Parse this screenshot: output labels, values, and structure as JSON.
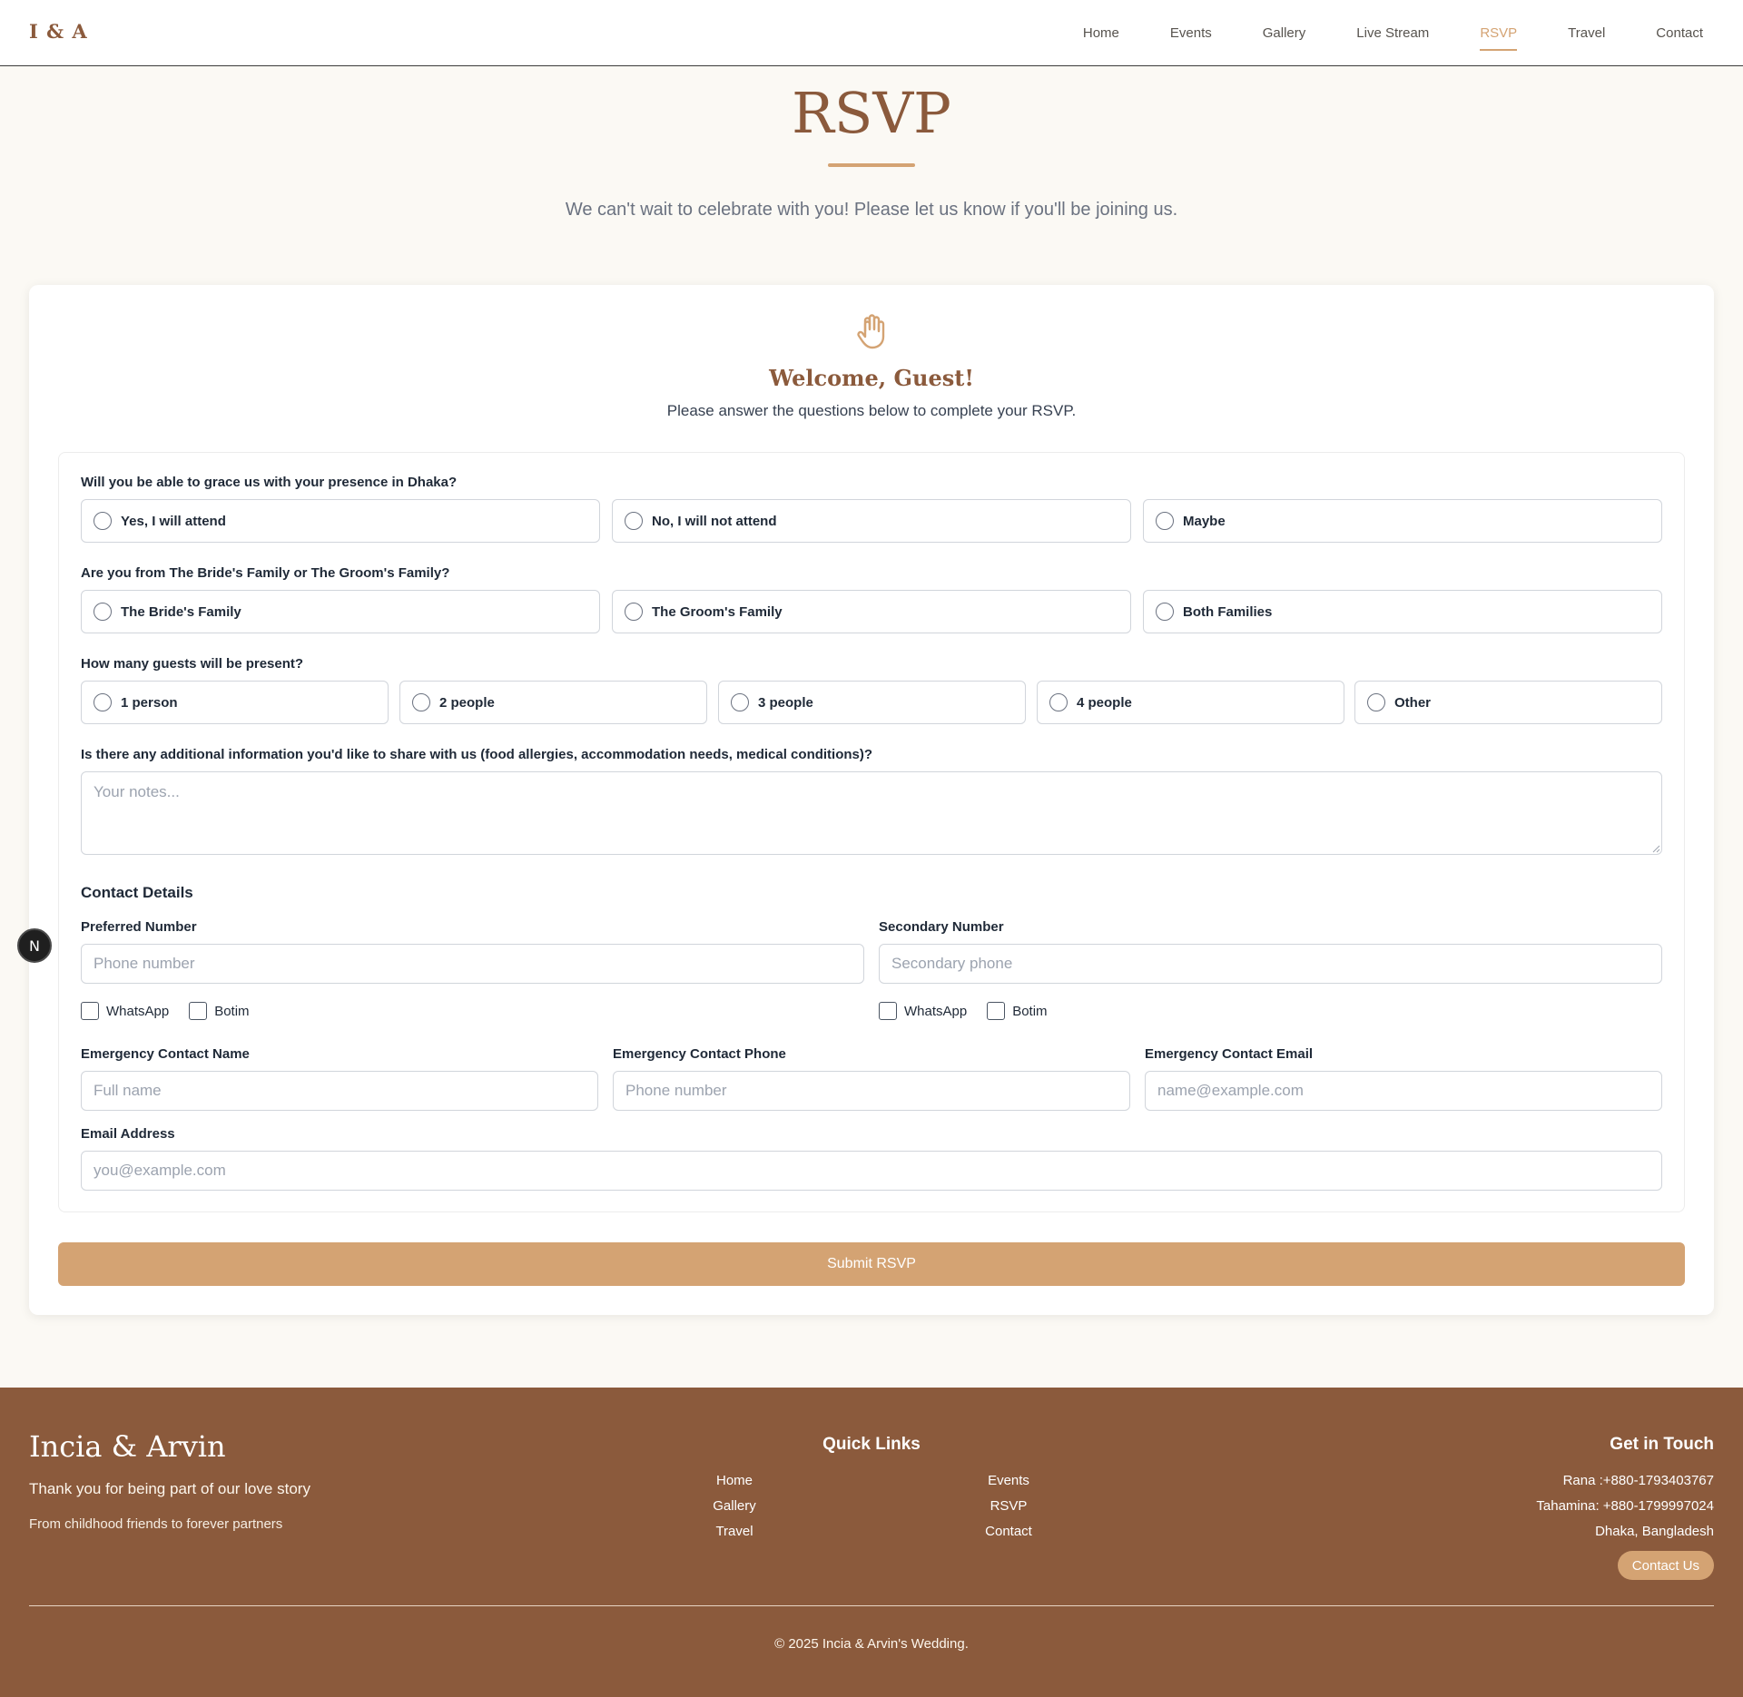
{
  "header": {
    "logo": "I & A",
    "nav": [
      "Home",
      "Events",
      "Gallery",
      "Live Stream",
      "RSVP",
      "Travel",
      "Contact"
    ],
    "active_nav": "RSVP"
  },
  "hero": {
    "title": "RSVP",
    "subtitle": "We can't wait to celebrate with you! Please let us know if you'll be joining us."
  },
  "welcome": {
    "icon": "waving-hand-icon",
    "title": "Welcome, Guest!",
    "subtitle": "Please answer the questions below to complete your RSVP."
  },
  "form": {
    "q_attend": {
      "label": "Will you be able to grace us with your presence in Dhaka?",
      "options": [
        "Yes, I will attend",
        "No, I will not attend",
        "Maybe"
      ]
    },
    "q_family": {
      "label": "Are you from The Bride's Family or The Groom's Family?",
      "options": [
        "The Bride's Family",
        "The Groom's Family",
        "Both Families"
      ]
    },
    "q_guests": {
      "label": "How many guests will be present?",
      "options": [
        "1 person",
        "2 people",
        "3 people",
        "4 people",
        "Other"
      ]
    },
    "q_notes": {
      "label": "Is there any additional information you'd like to share with us (food allergies, accommodation needs, medical conditions)?",
      "placeholder": "Your notes..."
    },
    "contact": {
      "title": "Contact Details",
      "preferred_label": "Preferred Number",
      "preferred_placeholder": "Phone number",
      "secondary_label": "Secondary Number",
      "secondary_placeholder": "Secondary phone",
      "whatsapp": "WhatsApp",
      "botim": "Botim",
      "em_name_label": "Emergency Contact Name",
      "em_name_placeholder": "Full name",
      "em_phone_label": "Emergency Contact Phone",
      "em_phone_placeholder": "Phone number",
      "em_email_label": "Emergency Contact Email",
      "em_email_placeholder": "name@example.com",
      "email_label": "Email Address",
      "email_placeholder": "you@example.com"
    },
    "submit": "Submit RSVP"
  },
  "floating_badge": "N",
  "footer": {
    "brand": "Incia & Arvin",
    "tagline": "Thank you for being part of our love story",
    "tagline2": "From childhood friends to forever partners",
    "quick_links_title": "Quick Links",
    "quick_links": [
      "Home",
      "Events",
      "Gallery",
      "RSVP",
      "Travel",
      "Contact"
    ],
    "get_in_touch_title": "Get in Touch",
    "contacts": [
      "Rana :+880-1793403767",
      "Tahamina: +880-1799997024",
      "Dhaka, Bangladesh"
    ],
    "contact_button": "Contact Us",
    "copyright": "© 2025 Incia & Arvin's Wedding."
  },
  "colors": {
    "brand_brown": "#8b5a3c",
    "accent_gold": "#d4a373",
    "page_bg": "#fbf9f4"
  }
}
